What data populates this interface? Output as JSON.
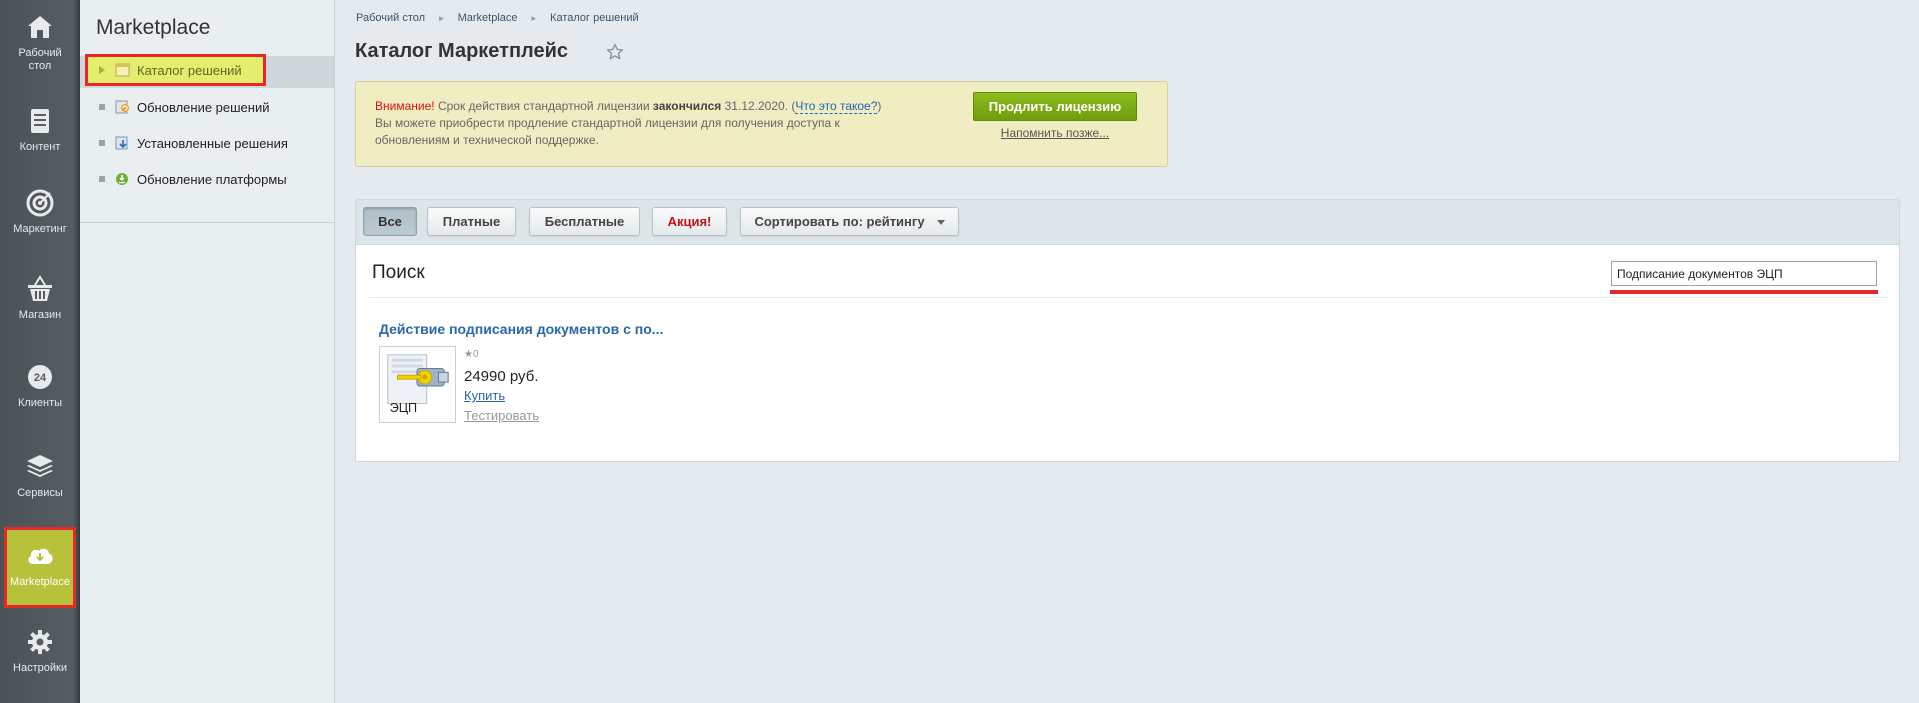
{
  "left_menu": {
    "items": [
      {
        "label": "Рабочий стол",
        "icon": "home-icon"
      },
      {
        "label": "Контент",
        "icon": "document-icon"
      },
      {
        "label": "Маркетинг",
        "icon": "target-icon"
      },
      {
        "label": "Магазин",
        "icon": "basket-icon"
      },
      {
        "label": "Клиенты",
        "icon": "clients-24-icon"
      },
      {
        "label": "Сервисы",
        "icon": "layers-icon"
      },
      {
        "label": "Marketplace",
        "icon": "cloud-download-icon"
      },
      {
        "label": "Настройки",
        "icon": "gear-icon"
      }
    ],
    "active": "Marketplace"
  },
  "sidebar": {
    "title": "Marketplace",
    "items": [
      {
        "label": "Каталог решений",
        "icon": "catalog-icon"
      },
      {
        "label": "Обновление решений",
        "icon": "update-icon"
      },
      {
        "label": "Установленные решения",
        "icon": "installed-icon"
      },
      {
        "label": "Обновление платформы",
        "icon": "platform-update-icon"
      }
    ]
  },
  "breadcrumb": [
    "Рабочий стол",
    "Marketplace",
    "Каталог решений"
  ],
  "page_title": "Каталог Маркетплейс",
  "alert": {
    "warning_word": "Внимание!",
    "text_before": " Срок действия стандартной лицензии ",
    "bold_word": "закончился",
    "date_text": " 31.12.2020. (",
    "link": "Что это такое?",
    "close_paren": ")",
    "line2": "Вы можете приобрести продление стандартной лицензии для получения доступа к обновлениям и технической поддержке.",
    "primary_button": "Продлить лицензию",
    "remind_link": "Напомнить позже..."
  },
  "filters": {
    "all": "Все",
    "paid": "Платные",
    "free": "Бесплатные",
    "sale": "Акция!",
    "sort": "Сортировать по: рейтингу"
  },
  "search": {
    "title": "Поиск",
    "value": "Подписание документов ЭЦП"
  },
  "result": {
    "title": "Действие подписания документов с по...",
    "thumb_label": "ЭЦП",
    "rating": "★0",
    "price": "24990 руб.",
    "buy": "Купить",
    "test": "Тестировать"
  },
  "colors": {
    "accent_green": "#7aab12",
    "highlight": "#e8272a",
    "active_menu": "#b7c13a",
    "link": "#2a67ad"
  }
}
